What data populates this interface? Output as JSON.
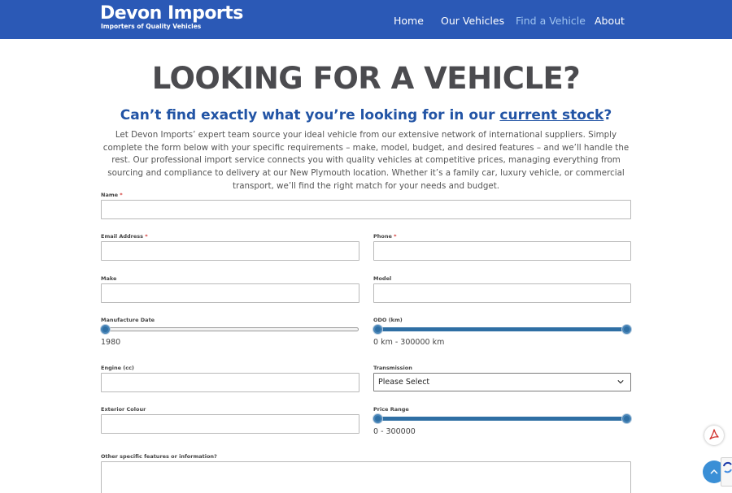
{
  "header": {
    "logo_title": "Devon Imports",
    "logo_tagline": "Importers of Quality Vehicles",
    "nav": [
      {
        "label": "Home"
      },
      {
        "label": "Our Vehicles"
      },
      {
        "label": "Find a Vehicle",
        "active": true
      },
      {
        "label": "About"
      }
    ]
  },
  "page": {
    "title": "LOOKING FOR A VEHICLE?",
    "subtitle_prefix": "Can’t find exactly what you’re looking for in our ",
    "subtitle_link": "current stock",
    "subtitle_suffix": "?",
    "intro": "Let Devon Imports’ expert team source your ideal vehicle from our extensive network of international suppliers. Simply complete the form below with your specific requirements – make, model, budget, and desired features – and we’ll handle the rest. Our professional import service connects you with quality vehicles at competitive prices, managing everything from sourcing and compliance to delivery at our New Plymouth location. Whether it’s a family car, luxury vehicle, or commercial transport, we’ll find the right match for your needs and budget."
  },
  "form": {
    "name": {
      "label": "Name",
      "required_mark": "*",
      "value": ""
    },
    "email": {
      "label": "Email Address",
      "required_mark": "*",
      "value": ""
    },
    "phone": {
      "label": "Phone",
      "required_mark": "*",
      "value": ""
    },
    "make": {
      "label": "Make",
      "value": ""
    },
    "model": {
      "label": "Model",
      "value": ""
    },
    "manufacture_date": {
      "label": "Manufacture Date",
      "value_text": "1980",
      "min": 1980,
      "selected": [
        1980
      ]
    },
    "odo": {
      "label": "ODO (km)",
      "value_text": "0 km - 300000 km",
      "min": 0,
      "max": 300000,
      "selected": [
        0,
        300000
      ]
    },
    "engine": {
      "label": "Engine (cc)",
      "value": ""
    },
    "transmission": {
      "label": "Transmission",
      "selected": "Please Select"
    },
    "exterior_colour": {
      "label": "Exterior Colour",
      "value": ""
    },
    "price_range": {
      "label": "Price Range",
      "value_text": "0 - 300000",
      "min": 0,
      "max": 300000,
      "selected": [
        0,
        300000
      ]
    },
    "other": {
      "label": "Other specific features or information?",
      "value": ""
    }
  },
  "widgets": {
    "pdf_icon": "pdf-icon",
    "scroll_top_icon": "chevron-up-icon",
    "recaptcha_icon": "recaptcha-icon"
  },
  "colors": {
    "header_bg": "#2b59b6",
    "nav_active": "#9ec3f0",
    "heading": "#4b4b4f",
    "subtitle": "#2254a5",
    "slider": "#2f6fa4",
    "required": "#d0312d"
  }
}
